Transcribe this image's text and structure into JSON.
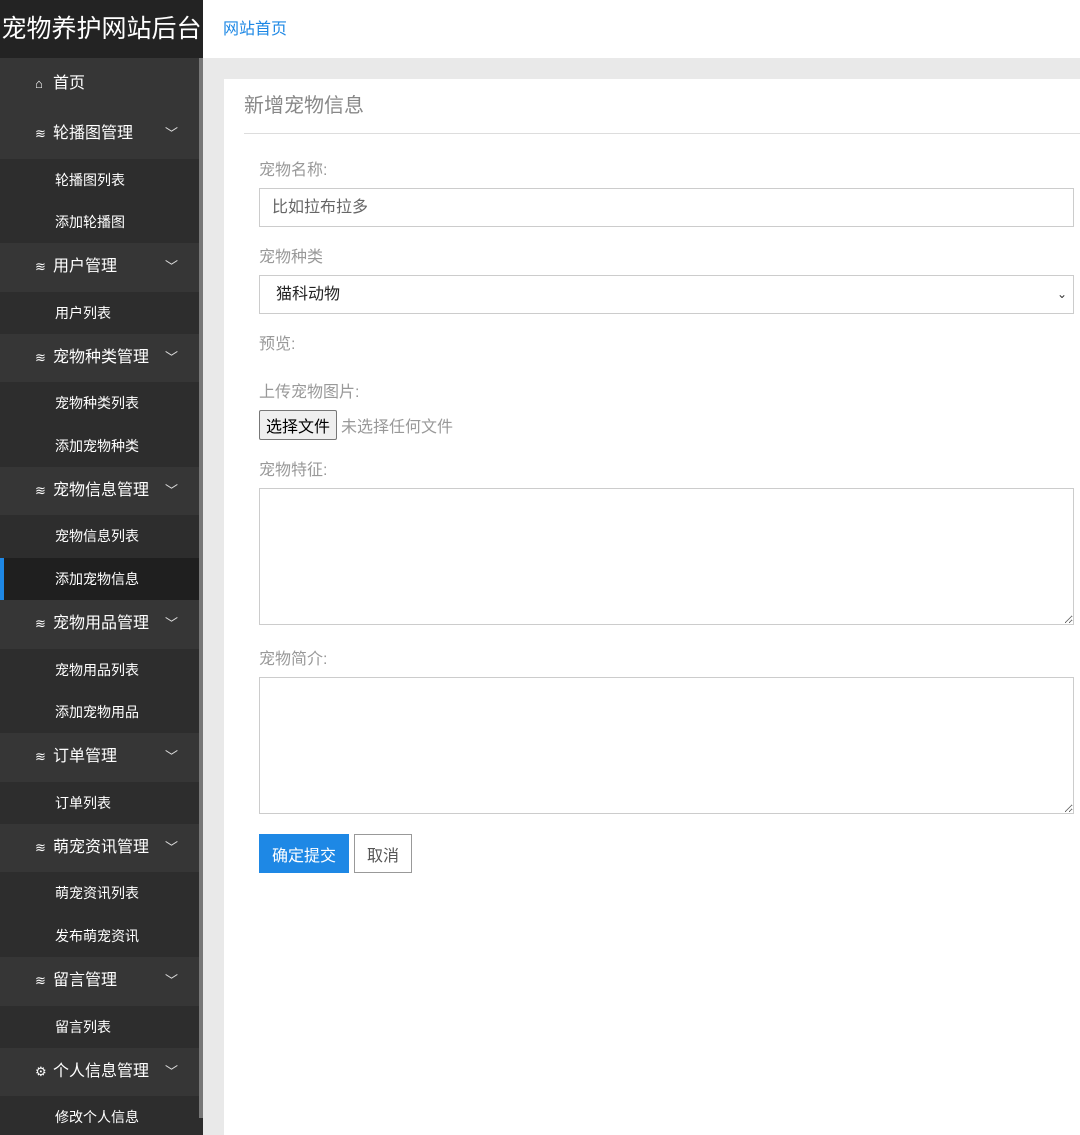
{
  "brand": "宠物养护网站后台",
  "topbar": {
    "home_link": "网站首页"
  },
  "sidebar": {
    "home": "首页",
    "groups": [
      {
        "label": "轮播图管理",
        "items": [
          "轮播图列表",
          "添加轮播图"
        ]
      },
      {
        "label": "用户管理",
        "items": [
          "用户列表"
        ]
      },
      {
        "label": "宠物种类管理",
        "items": [
          "宠物种类列表",
          "添加宠物种类"
        ]
      },
      {
        "label": "宠物信息管理",
        "items": [
          "宠物信息列表",
          "添加宠物信息"
        ]
      },
      {
        "label": "宠物用品管理",
        "items": [
          "宠物用品列表",
          "添加宠物用品"
        ]
      },
      {
        "label": "订单管理",
        "items": [
          "订单列表"
        ]
      },
      {
        "label": "萌宠资讯管理",
        "items": [
          "萌宠资讯列表",
          "发布萌宠资讯"
        ]
      },
      {
        "label": "留言管理",
        "items": [
          "留言列表"
        ]
      },
      {
        "label": "个人信息管理",
        "items": [
          "修改个人信息"
        ]
      }
    ],
    "active": "添加宠物信息"
  },
  "form": {
    "title": "新增宠物信息",
    "name_label": "宠物名称:",
    "name_placeholder": "比如拉布拉多",
    "type_label": "宠物种类",
    "type_value": "猫科动物",
    "preview_label": "预览:",
    "upload_label": "上传宠物图片:",
    "choose_file": "选择文件",
    "no_file": "未选择任何文件",
    "feature_label": "宠物特征:",
    "intro_label": "宠物简介:",
    "submit": "确定提交",
    "cancel": "取消"
  }
}
